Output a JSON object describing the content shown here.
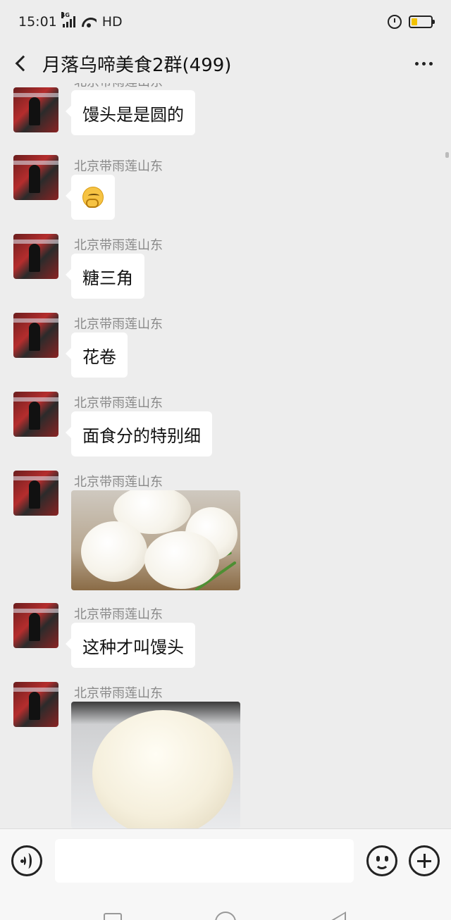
{
  "status_bar": {
    "time": "15:01",
    "network": "4G",
    "hd": "HD"
  },
  "header": {
    "title": "月落乌啼美食2群(499)"
  },
  "messages": [
    {
      "sender": "北京带雨莲山东",
      "type": "text",
      "text": "馒头是是圆的"
    },
    {
      "sender": "北京带雨莲山东",
      "type": "emoji",
      "emoji": "thinking-face-icon"
    },
    {
      "sender": "北京带雨莲山东",
      "type": "text",
      "text": "糖三角"
    },
    {
      "sender": "北京带雨莲山东",
      "type": "text",
      "text": "花卷"
    },
    {
      "sender": "北京带雨莲山东",
      "type": "text",
      "text": "面食分的特别细"
    },
    {
      "sender": "北京带雨莲山东",
      "type": "image"
    },
    {
      "sender": "北京带雨莲山东",
      "type": "text",
      "text": "这种才叫馒头"
    },
    {
      "sender": "北京带雨莲山东",
      "type": "image"
    }
  ],
  "input": {
    "placeholder": ""
  },
  "colors": {
    "background": "#ededed",
    "bubble": "#ffffff",
    "sender_text": "#8a8a8a",
    "battery": "#f2c200"
  }
}
